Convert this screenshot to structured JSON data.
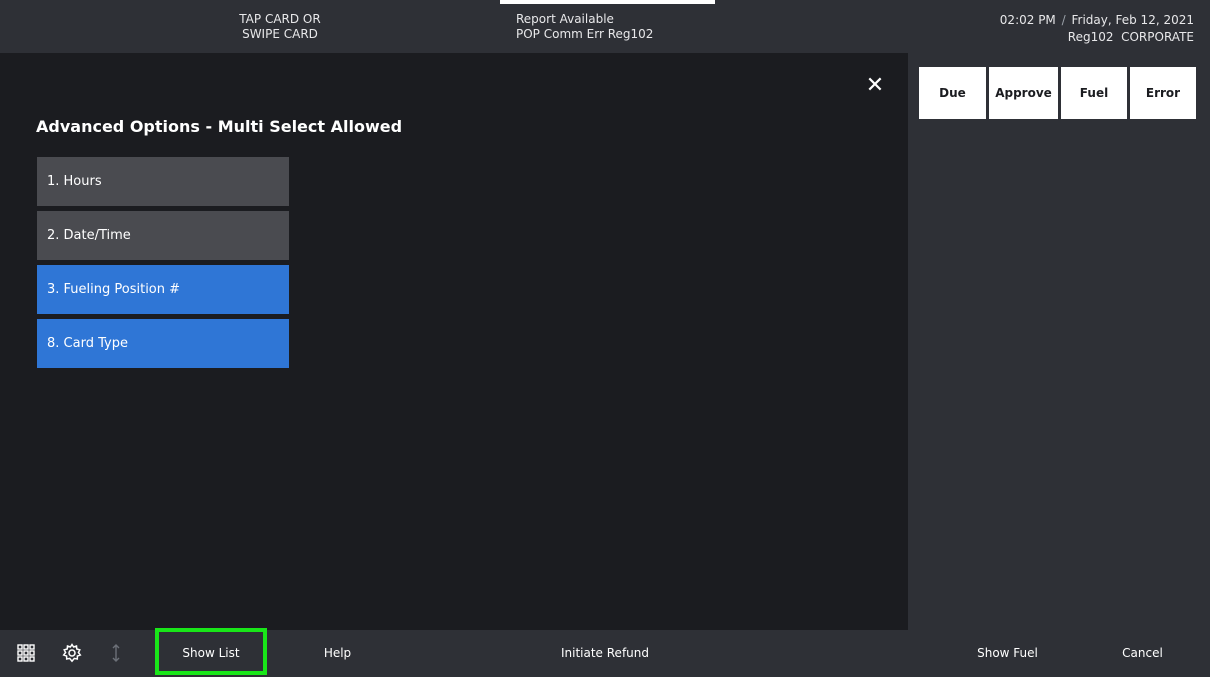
{
  "topbar": {
    "prompt_line1": "TAP CARD OR",
    "prompt_line2": "SWIPE CARD",
    "status_line1": "Report Available",
    "status_line2": "POP Comm Err Reg102",
    "time": "02:02 PM",
    "separator": "/",
    "date": "Friday, Feb 12, 2021",
    "register": "Reg102",
    "site": "CORPORATE"
  },
  "main": {
    "title": "Advanced Options - Multi Select Allowed",
    "close_icon": "close-icon",
    "options": [
      {
        "label": "1. Hours",
        "selected": false
      },
      {
        "label": "2. Date/Time",
        "selected": false
      },
      {
        "label": "3. Fueling Position #",
        "selected": true
      },
      {
        "label": "8. Card Type",
        "selected": true
      }
    ]
  },
  "right_panel": {
    "filters": [
      "Due",
      "Approve",
      "Fuel",
      "Error"
    ]
  },
  "bottombar": {
    "icons": [
      "grid-menu-icon",
      "settings-icon",
      "sort-arrows-icon"
    ],
    "show_list": "Show List",
    "help": "Help",
    "initiate_refund": "Initiate Refund",
    "show_fuel": "Show Fuel",
    "cancel": "Cancel"
  },
  "colors": {
    "background": "#1b1c20",
    "panel": "#2e3036",
    "option_default": "#4a4b50",
    "option_selected": "#2f76d6",
    "highlight": "#19e619"
  }
}
